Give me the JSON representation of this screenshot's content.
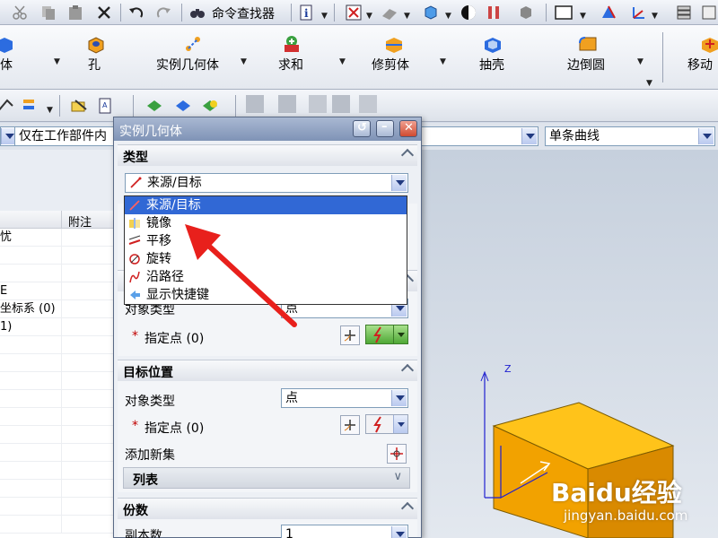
{
  "toolbar": {
    "command_finder_label": "命令查找器"
  },
  "ribbon": {
    "items": [
      {
        "label": "体"
      },
      {
        "label": "孔"
      },
      {
        "label": "实例几何体"
      },
      {
        "label": "求和"
      },
      {
        "label": "修剪体"
      },
      {
        "label": "抽壳"
      },
      {
        "label": "边倒圆"
      },
      {
        "label": "移动"
      }
    ]
  },
  "filterbar": {
    "scope_value": "仅在工作部件内",
    "curve_rule_value": "单条曲线"
  },
  "navigator": {
    "column_header": "附注",
    "rows": [
      "忧",
      "",
      "",
      "E",
      "坐标系 (0)",
      "1)",
      "",
      "",
      "",
      "",
      "",
      "",
      "",
      "",
      "",
      "",
      ""
    ]
  },
  "dialog": {
    "title": "实例几何体",
    "type_section": {
      "header": "类型",
      "selected": "来源/目标",
      "options": [
        {
          "label": "来源/目标",
          "icon": "source-target-icon",
          "selected": true
        },
        {
          "label": "镜像",
          "icon": "mirror-icon",
          "selected": false
        },
        {
          "label": "平移",
          "icon": "translate-icon",
          "selected": false
        },
        {
          "label": "旋转",
          "icon": "rotate-icon",
          "selected": false
        },
        {
          "label": "沿路径",
          "icon": "along-path-icon",
          "selected": false
        },
        {
          "label": "显示快捷键",
          "icon": "shortcut-icon",
          "selected": false
        }
      ]
    },
    "source_section": {
      "object_type_label": "对象类型",
      "object_type_value": "点",
      "specify_point_label": "指定点 (0)",
      "required_mark": "*"
    },
    "target_section": {
      "header": "目标位置",
      "object_type_label": "对象类型",
      "object_type_value": "点",
      "specify_point_label": "指定点 (0)",
      "required_mark": "*",
      "add_new_set_label": "添加新集",
      "list_label": "列表"
    },
    "copies_section": {
      "header": "份数",
      "copies_label": "副本数",
      "copies_value": "1"
    }
  },
  "viewport": {
    "axis_label": "Z",
    "body_color": "#f2a200"
  },
  "watermark": {
    "text": "Baidu经验",
    "subtext": "jingyan.baidu.com"
  }
}
